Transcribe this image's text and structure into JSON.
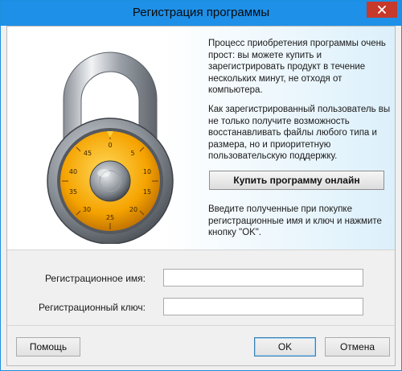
{
  "window": {
    "title": "Регистрация программы",
    "accent_color": "#1e90e8",
    "close_icon": "close-icon"
  },
  "banner": {
    "lock_icon": "padlock-icon",
    "dial_numbers": [
      "0",
      "5",
      "10",
      "15",
      "20",
      "25",
      "30",
      "35",
      "40",
      "45"
    ],
    "paragraph1": "Процесс приобретения программы очень прост: вы можете купить и зарегистрировать продукт в течение нескольких минут, не отходя от компьютера.",
    "paragraph2": "Как зарегистрированный пользователь вы не только получите возможность восстанавливать файлы любого типа и размера, но и приоритетную пользовательскую поддержку.",
    "buy_button": "Купить программу онлайн",
    "paragraph3": "Введите полученные при покупке регистрационные имя и ключ и нажмите кнопку \"OK\"."
  },
  "form": {
    "name_label": "Регистрационное имя:",
    "name_value": "",
    "key_label": "Регистрационный ключ:",
    "key_value": ""
  },
  "buttons": {
    "help": "Помощь",
    "ok": "OK",
    "cancel": "Отмена"
  }
}
